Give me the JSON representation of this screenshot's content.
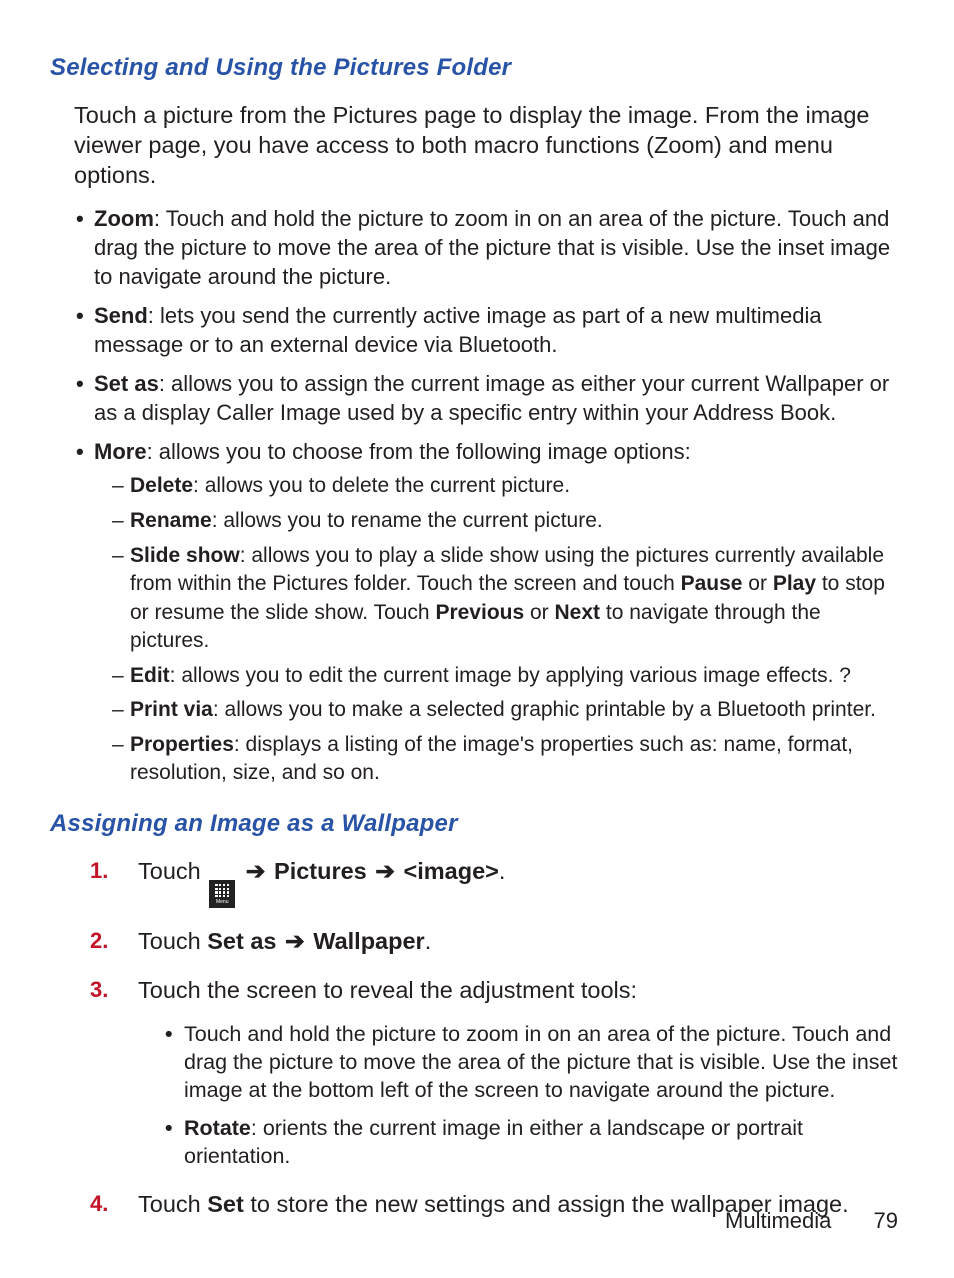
{
  "section1": {
    "heading": "Selecting and Using the Pictures Folder",
    "intro": "Touch a picture from the Pictures page to display the image. From the image viewer page, you have access to both macro functions (Zoom) and menu options.",
    "items": [
      {
        "term": "Zoom",
        "desc": ": Touch and hold the picture to zoom in on an area of the picture. Touch and drag the picture to move the area of the picture that is visible. Use the inset image to navigate around the picture."
      },
      {
        "term": "Send",
        "desc": ": lets you send the currently active image as part of a new multimedia message or to an external device via Bluetooth."
      },
      {
        "term": "Set as",
        "desc": ": allows you to assign the current image as either your current Wallpaper or as a display Caller Image used by a specific entry within your Address Book."
      },
      {
        "term": "More",
        "desc": ": allows you to choose from the following image options:"
      }
    ],
    "more_sub": [
      {
        "term": "Delete",
        "desc": ": allows you to delete the current picture."
      },
      {
        "term": "Rename",
        "desc": ": allows you to rename the current picture."
      },
      {
        "term": "Slide show",
        "desc_pre": ": allows you to play a slide show using the pictures currently available from within the Pictures folder. Touch the screen and touch ",
        "b1": "Pause",
        "mid1": " or ",
        "b2": "Play",
        "desc_mid": " to stop or resume the slide show. Touch ",
        "b3": "Previous",
        "mid2": " or ",
        "b4": "Next",
        "desc_post": " to navigate through the pictures."
      },
      {
        "term": "Edit",
        "desc": ": allows you to edit the current image by applying various image effects. ?"
      },
      {
        "term": "Print via",
        "desc": ": allows you to make a selected graphic printable by a Bluetooth printer."
      },
      {
        "term": "Properties",
        "desc": ": displays a listing of the image's properties such as: name, format, resolution, size, and so on."
      }
    ]
  },
  "section2": {
    "heading": "Assigning an Image as a Wallpaper",
    "step1": {
      "pre": "Touch ",
      "menu_label": "Menu",
      "arrow": "➔",
      "b1": "Pictures",
      "b2": "<image>",
      "period": "."
    },
    "step2": {
      "pre": "Touch ",
      "b1": "Set as",
      "arrow": "➔",
      "b2": "Wallpaper",
      "period": "."
    },
    "step3": {
      "text": "Touch the screen to reveal the adjustment tools:",
      "inner": [
        {
          "text": "Touch and hold the picture to zoom in on an area of the picture. Touch and drag the picture to move the area of the picture that is visible. Use the inset image at the bottom left of the screen to navigate around the picture."
        },
        {
          "term": "Rotate",
          "desc": ": orients the current image in either a landscape or portrait orientation."
        }
      ]
    },
    "step4": {
      "pre": "Touch ",
      "b1": "Set",
      "post": " to store the new settings and assign the wallpaper image."
    }
  },
  "footer": {
    "section": "Multimedia",
    "page": "79"
  }
}
